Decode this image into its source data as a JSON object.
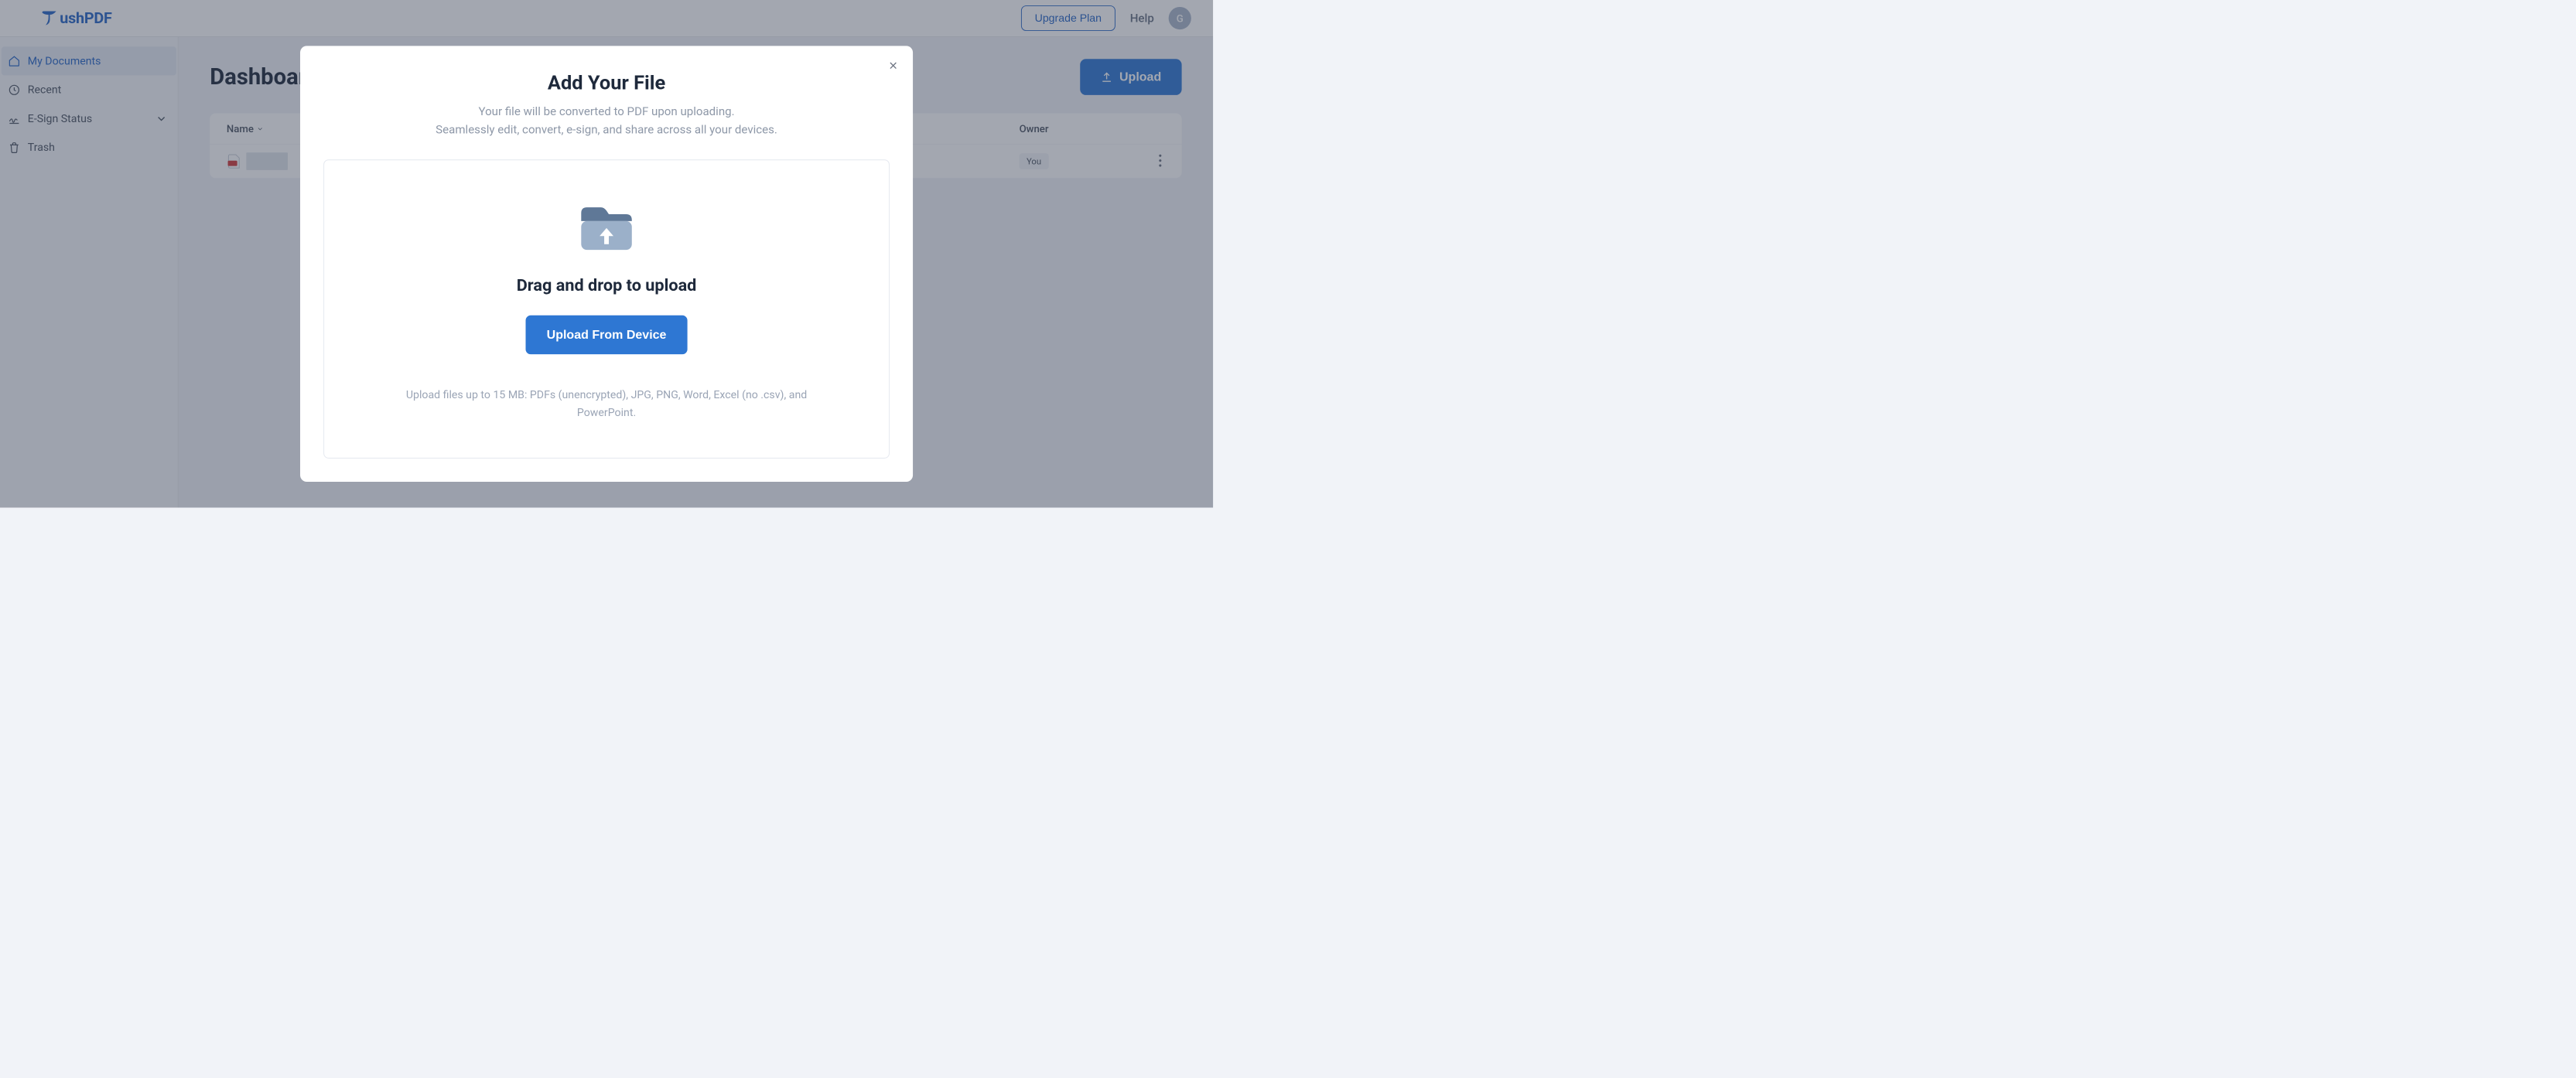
{
  "header": {
    "brand": "ushPDF",
    "upgrade": "Upgrade Plan",
    "help": "Help",
    "avatar_initial": "G"
  },
  "sidebar": {
    "items": [
      {
        "label": "My Documents",
        "icon": "home-icon",
        "active": true
      },
      {
        "label": "Recent",
        "icon": "clock-icon",
        "active": false
      },
      {
        "label": "E-Sign Status",
        "icon": "signature-icon",
        "active": false,
        "expandable": true
      },
      {
        "label": "Trash",
        "icon": "trash-icon",
        "active": false
      }
    ]
  },
  "main": {
    "title": "Dashboard",
    "upload_label": "Upload",
    "columns": {
      "name": "Name",
      "owner": "Owner"
    },
    "rows": [
      {
        "owner": "You"
      }
    ]
  },
  "modal": {
    "title": "Add Your File",
    "subtitle_line1": "Your file will be converted to PDF upon uploading.",
    "subtitle_line2": "Seamlessly edit, convert, e-sign, and share across all your devices.",
    "drop_title": "Drag and drop to upload",
    "device_button": "Upload From Device",
    "note": "Upload files up to 15 MB: PDFs (unencrypted), JPG, PNG, Word, Excel (no .csv), and PowerPoint."
  }
}
